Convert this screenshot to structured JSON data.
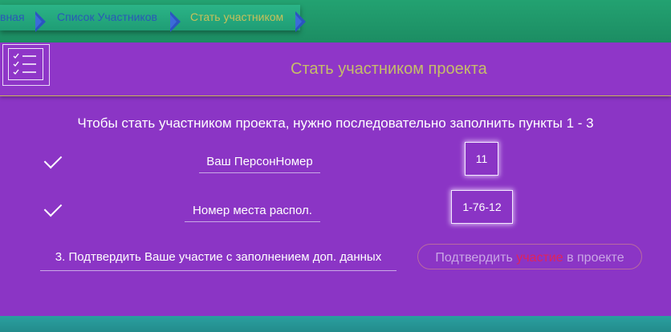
{
  "breadcrumb": {
    "items": [
      {
        "label": "вная"
      },
      {
        "label": "Список Участников"
      },
      {
        "label": "Стать участником"
      }
    ]
  },
  "header": {
    "title": "Стать участником проекта",
    "logo_icon": "checklist-icon"
  },
  "intro_text": "Чтобы стать участником проекта, нужно последовательно заполнить пункты 1 - 3",
  "steps": [
    {
      "label": "Ваш ПерсонНомер",
      "value": "11",
      "done": true,
      "icon": "checkmark-icon"
    },
    {
      "label": "Номер места распол.",
      "value": "1-76-12",
      "done": true,
      "icon": "checkmark-icon"
    }
  ],
  "step3": {
    "label": "3. Подтвердить Ваше участие с заполнением доп. данных"
  },
  "confirm": {
    "part1": "Подтвердить ",
    "part2": "участие",
    "part3": " в проекте"
  },
  "colors": {
    "panel": "#8b35c5",
    "top_bar": "#1f9a6e",
    "title_text": "#c6bd69",
    "highlight": "#e0245a"
  }
}
